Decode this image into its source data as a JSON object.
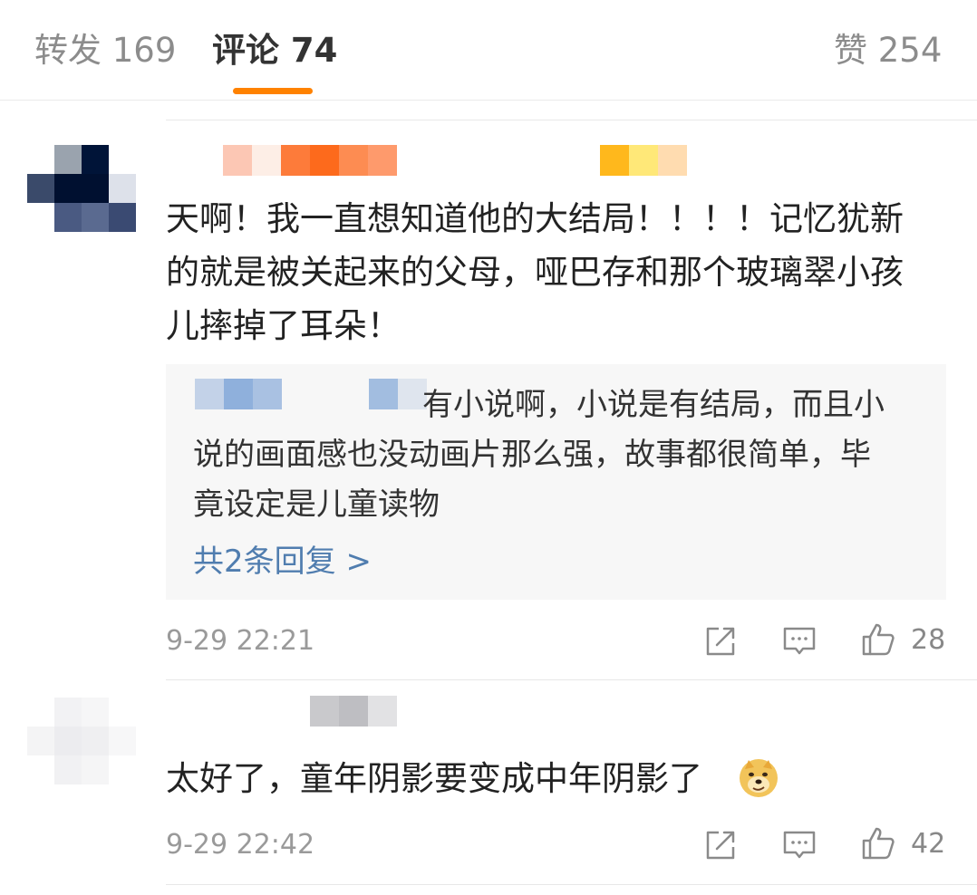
{
  "tabs": {
    "repost": "转发 169",
    "comments": "评论 74",
    "likes": "赞 254"
  },
  "accent_color": "#ff8200",
  "link_color": "#507daf",
  "comments": [
    {
      "text_lines": [
        "天啊！我一直想知道他的大结局！！！！记忆犹新",
        "的就是被关起来的父母，哑巴存和那个玻璃翠小孩",
        "儿摔掉了耳朵！"
      ],
      "quoted_reply": {
        "visible_text_lines": [
          "有小说啊，小说是有结局，而且小",
          "说的画面感也没动画片那么强，故事都很简单，毕",
          "竟设定是儿童读物"
        ],
        "more_replies": "共2条回复 >"
      },
      "time": "9-29 22:21",
      "like_count": "28"
    },
    {
      "text": "太好了，童年阴影要变成中年阴影了",
      "emoji": "doge-emoji",
      "time": "9-29 22:42",
      "like_count": "42"
    }
  ],
  "icons": {
    "repost": "repost-icon",
    "comment": "comment-icon",
    "like": "thumbs-up-icon"
  }
}
